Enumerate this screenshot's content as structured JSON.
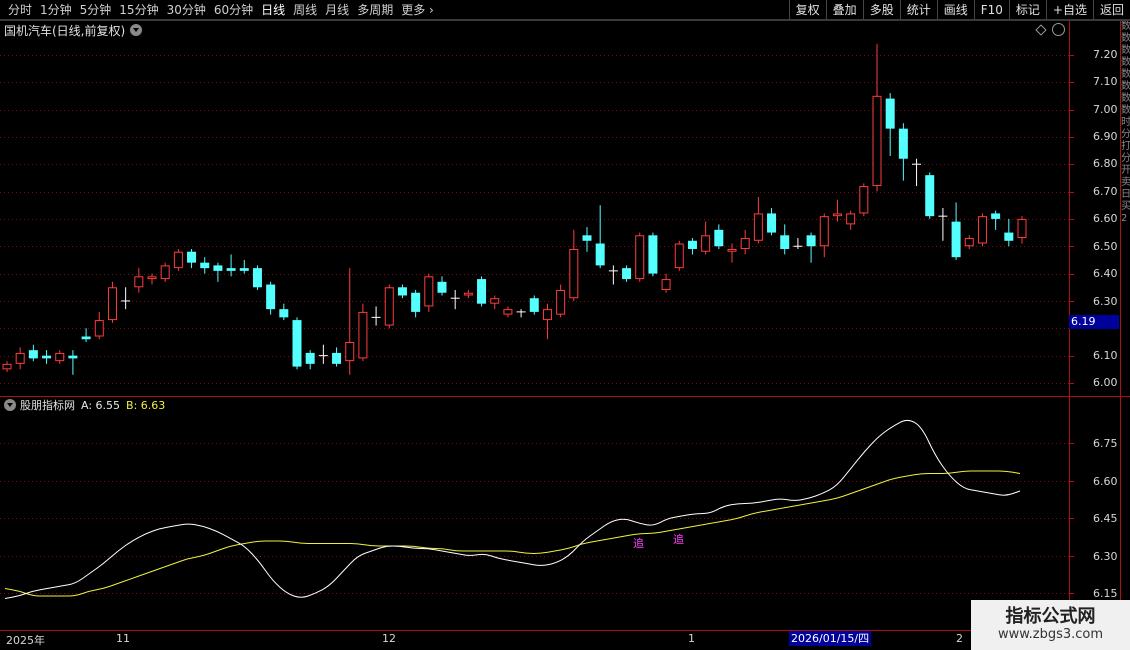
{
  "toolbar": {
    "periods": [
      "分时",
      "1分钟",
      "5分钟",
      "15分钟",
      "30分钟",
      "60分钟",
      "日线",
      "周线",
      "月线",
      "多周期",
      "更多"
    ],
    "active_period": "日线",
    "more_chevron": "›",
    "right_buttons": [
      "复权",
      "叠加",
      "多股",
      "统计",
      "画线",
      "F10",
      "标记",
      "+自选",
      "返回"
    ]
  },
  "main_chart": {
    "title": "国机汽车(日线,前复权)",
    "price_ticks": [
      "7.20",
      "7.10",
      "7.00",
      "6.90",
      "6.80",
      "6.70",
      "6.60",
      "6.50",
      "6.40",
      "6.30",
      "6.10",
      "6.00"
    ],
    "current_price_tag": "6.19"
  },
  "indicator": {
    "name": "股朋指标网",
    "a_label": "A: 6.55",
    "b_label": "B: 6.63",
    "ticks": [
      "6.75",
      "6.60",
      "6.45",
      "6.30",
      "6.15"
    ],
    "markers": [
      "追",
      "追"
    ]
  },
  "date_axis": {
    "labels": [
      "2025年",
      "11",
      "12",
      "1",
      "2"
    ],
    "highlight": "2026/01/15/四"
  },
  "side_strip": [
    "数",
    "数",
    "数",
    "数",
    "数",
    "数",
    "数",
    "数",
    "时",
    "分",
    "打",
    "分",
    "开",
    "卖",
    "日",
    "买",
    "2"
  ],
  "watermark": {
    "title": "指标公式网",
    "url": "www.zbgs3.com"
  },
  "colors": {
    "up": "#ff3c3c",
    "down": "#54ffff",
    "line_a": "#ffffff",
    "line_b": "#f0f040",
    "grid": "#7a1010",
    "price_tag_bg": "#00009a"
  },
  "chart_data": {
    "type": "candlestick",
    "ylim": [
      6.0,
      7.25
    ],
    "candles": [
      {
        "o": 6.05,
        "c": 6.07,
        "h": 6.08,
        "l": 6.04,
        "d": "up"
      },
      {
        "o": 6.07,
        "c": 6.11,
        "h": 6.13,
        "l": 6.05,
        "d": "up"
      },
      {
        "o": 6.12,
        "c": 6.09,
        "h": 6.14,
        "l": 6.08,
        "d": "down"
      },
      {
        "o": 6.1,
        "c": 6.09,
        "h": 6.12,
        "l": 6.07,
        "d": "down"
      },
      {
        "o": 6.08,
        "c": 6.11,
        "h": 6.12,
        "l": 6.07,
        "d": "up"
      },
      {
        "o": 6.1,
        "c": 6.09,
        "h": 6.12,
        "l": 6.03,
        "d": "down"
      },
      {
        "o": 6.17,
        "c": 6.16,
        "h": 6.2,
        "l": 6.15,
        "d": "down"
      },
      {
        "o": 6.17,
        "c": 6.23,
        "h": 6.26,
        "l": 6.16,
        "d": "up"
      },
      {
        "o": 6.23,
        "c": 6.35,
        "h": 6.37,
        "l": 6.22,
        "d": "up"
      },
      {
        "o": 6.3,
        "c": 6.3,
        "h": 6.35,
        "l": 6.27,
        "d": "flat"
      },
      {
        "o": 6.35,
        "c": 6.39,
        "h": 6.42,
        "l": 6.33,
        "d": "up"
      },
      {
        "o": 6.38,
        "c": 6.39,
        "h": 6.4,
        "l": 6.36,
        "d": "up"
      },
      {
        "o": 6.38,
        "c": 6.43,
        "h": 6.44,
        "l": 6.37,
        "d": "up"
      },
      {
        "o": 6.42,
        "c": 6.48,
        "h": 6.49,
        "l": 6.41,
        "d": "up"
      },
      {
        "o": 6.48,
        "c": 6.44,
        "h": 6.49,
        "l": 6.42,
        "d": "down"
      },
      {
        "o": 6.44,
        "c": 6.42,
        "h": 6.46,
        "l": 6.4,
        "d": "down"
      },
      {
        "o": 6.43,
        "c": 6.41,
        "h": 6.44,
        "l": 6.37,
        "d": "down"
      },
      {
        "o": 6.42,
        "c": 6.41,
        "h": 6.47,
        "l": 6.39,
        "d": "down"
      },
      {
        "o": 6.42,
        "c": 6.41,
        "h": 6.45,
        "l": 6.4,
        "d": "down"
      },
      {
        "o": 6.42,
        "c": 6.35,
        "h": 6.43,
        "l": 6.34,
        "d": "down"
      },
      {
        "o": 6.36,
        "c": 6.27,
        "h": 6.37,
        "l": 6.25,
        "d": "down"
      },
      {
        "o": 6.27,
        "c": 6.24,
        "h": 6.29,
        "l": 6.23,
        "d": "down"
      },
      {
        "o": 6.23,
        "c": 6.06,
        "h": 6.24,
        "l": 6.05,
        "d": "down"
      },
      {
        "o": 6.11,
        "c": 6.07,
        "h": 6.12,
        "l": 6.05,
        "d": "down"
      },
      {
        "o": 6.1,
        "c": 6.1,
        "h": 6.14,
        "l": 6.07,
        "d": "flat"
      },
      {
        "o": 6.11,
        "c": 6.07,
        "h": 6.13,
        "l": 6.06,
        "d": "down"
      },
      {
        "o": 6.08,
        "c": 6.15,
        "h": 6.42,
        "l": 6.03,
        "d": "up"
      },
      {
        "o": 6.09,
        "c": 6.26,
        "h": 6.29,
        "l": 6.08,
        "d": "up"
      },
      {
        "o": 6.24,
        "c": 6.24,
        "h": 6.28,
        "l": 6.21,
        "d": "flat"
      },
      {
        "o": 6.21,
        "c": 6.35,
        "h": 6.36,
        "l": 6.2,
        "d": "up"
      },
      {
        "o": 6.35,
        "c": 6.32,
        "h": 6.36,
        "l": 6.31,
        "d": "down"
      },
      {
        "o": 6.33,
        "c": 6.26,
        "h": 6.34,
        "l": 6.24,
        "d": "down"
      },
      {
        "o": 6.28,
        "c": 6.39,
        "h": 6.4,
        "l": 6.26,
        "d": "up"
      },
      {
        "o": 6.37,
        "c": 6.33,
        "h": 6.39,
        "l": 6.32,
        "d": "down"
      },
      {
        "o": 6.31,
        "c": 6.31,
        "h": 6.34,
        "l": 6.27,
        "d": "flat"
      },
      {
        "o": 6.32,
        "c": 6.33,
        "h": 6.34,
        "l": 6.31,
        "d": "up"
      },
      {
        "o": 6.38,
        "c": 6.29,
        "h": 6.39,
        "l": 6.28,
        "d": "down"
      },
      {
        "o": 6.29,
        "c": 6.31,
        "h": 6.32,
        "l": 6.27,
        "d": "up"
      },
      {
        "o": 6.25,
        "c": 6.27,
        "h": 6.28,
        "l": 6.24,
        "d": "up"
      },
      {
        "o": 6.26,
        "c": 6.26,
        "h": 6.27,
        "l": 6.24,
        "d": "flat"
      },
      {
        "o": 6.31,
        "c": 6.26,
        "h": 6.32,
        "l": 6.25,
        "d": "down"
      },
      {
        "o": 6.23,
        "c": 6.27,
        "h": 6.29,
        "l": 6.16,
        "d": "up"
      },
      {
        "o": 6.25,
        "c": 6.34,
        "h": 6.36,
        "l": 6.24,
        "d": "up"
      },
      {
        "o": 6.31,
        "c": 6.49,
        "h": 6.56,
        "l": 6.3,
        "d": "up"
      },
      {
        "o": 6.54,
        "c": 6.52,
        "h": 6.57,
        "l": 6.48,
        "d": "down"
      },
      {
        "o": 6.51,
        "c": 6.43,
        "h": 6.65,
        "l": 6.42,
        "d": "down"
      },
      {
        "o": 6.41,
        "c": 6.41,
        "h": 6.43,
        "l": 6.36,
        "d": "flat"
      },
      {
        "o": 6.42,
        "c": 6.38,
        "h": 6.43,
        "l": 6.37,
        "d": "down"
      },
      {
        "o": 6.38,
        "c": 6.54,
        "h": 6.55,
        "l": 6.37,
        "d": "up"
      },
      {
        "o": 6.54,
        "c": 6.4,
        "h": 6.55,
        "l": 6.39,
        "d": "down"
      },
      {
        "o": 6.34,
        "c": 6.38,
        "h": 6.4,
        "l": 6.33,
        "d": "up"
      },
      {
        "o": 6.42,
        "c": 6.51,
        "h": 6.52,
        "l": 6.41,
        "d": "up"
      },
      {
        "o": 6.52,
        "c": 6.49,
        "h": 6.53,
        "l": 6.47,
        "d": "down"
      },
      {
        "o": 6.48,
        "c": 6.54,
        "h": 6.59,
        "l": 6.47,
        "d": "up"
      },
      {
        "o": 6.56,
        "c": 6.5,
        "h": 6.58,
        "l": 6.49,
        "d": "down"
      },
      {
        "o": 6.48,
        "c": 6.49,
        "h": 6.51,
        "l": 6.44,
        "d": "up"
      },
      {
        "o": 6.49,
        "c": 6.53,
        "h": 6.56,
        "l": 6.47,
        "d": "up"
      },
      {
        "o": 6.52,
        "c": 6.62,
        "h": 6.68,
        "l": 6.51,
        "d": "up"
      },
      {
        "o": 6.62,
        "c": 6.55,
        "h": 6.64,
        "l": 6.54,
        "d": "down"
      },
      {
        "o": 6.54,
        "c": 6.49,
        "h": 6.58,
        "l": 6.47,
        "d": "down"
      },
      {
        "o": 6.5,
        "c": 6.5,
        "h": 6.53,
        "l": 6.49,
        "d": "flat"
      },
      {
        "o": 6.54,
        "c": 6.5,
        "h": 6.55,
        "l": 6.44,
        "d": "down"
      },
      {
        "o": 6.5,
        "c": 6.61,
        "h": 6.62,
        "l": 6.46,
        "d": "up"
      },
      {
        "o": 6.61,
        "c": 6.62,
        "h": 6.67,
        "l": 6.59,
        "d": "up"
      },
      {
        "o": 6.58,
        "c": 6.62,
        "h": 6.63,
        "l": 6.56,
        "d": "up"
      },
      {
        "o": 6.62,
        "c": 6.72,
        "h": 6.73,
        "l": 6.61,
        "d": "up"
      },
      {
        "o": 6.72,
        "c": 7.05,
        "h": 7.24,
        "l": 6.7,
        "d": "up"
      },
      {
        "o": 7.04,
        "c": 6.93,
        "h": 7.06,
        "l": 6.83,
        "d": "down"
      },
      {
        "o": 6.93,
        "c": 6.82,
        "h": 6.95,
        "l": 6.74,
        "d": "down"
      },
      {
        "o": 6.8,
        "c": 6.8,
        "h": 6.82,
        "l": 6.72,
        "d": "flat"
      },
      {
        "o": 6.76,
        "c": 6.61,
        "h": 6.77,
        "l": 6.6,
        "d": "down"
      },
      {
        "o": 6.61,
        "c": 6.61,
        "h": 6.64,
        "l": 6.52,
        "d": "flat"
      },
      {
        "o": 6.59,
        "c": 6.46,
        "h": 6.66,
        "l": 6.45,
        "d": "down"
      },
      {
        "o": 6.5,
        "c": 6.53,
        "h": 6.54,
        "l": 6.49,
        "d": "up"
      },
      {
        "o": 6.51,
        "c": 6.61,
        "h": 6.62,
        "l": 6.5,
        "d": "up"
      },
      {
        "o": 6.62,
        "c": 6.6,
        "h": 6.63,
        "l": 6.56,
        "d": "down"
      },
      {
        "o": 6.55,
        "c": 6.52,
        "h": 6.6,
        "l": 6.5,
        "d": "down"
      },
      {
        "o": 6.53,
        "c": 6.6,
        "h": 6.61,
        "l": 6.51,
        "d": "up"
      }
    ],
    "indicator_ylim": [
      6.15,
      6.83
    ],
    "indicator_a": [
      6.13,
      6.14,
      6.16,
      6.17,
      6.18,
      6.19,
      6.23,
      6.27,
      6.32,
      6.36,
      6.39,
      6.41,
      6.42,
      6.43,
      6.42,
      6.4,
      6.37,
      6.34,
      6.28,
      6.2,
      6.15,
      6.13,
      6.15,
      6.18,
      6.24,
      6.3,
      6.32,
      6.34,
      6.34,
      6.33,
      6.33,
      6.32,
      6.31,
      6.3,
      6.31,
      6.29,
      6.28,
      6.27,
      6.26,
      6.27,
      6.3,
      6.36,
      6.4,
      6.44,
      6.45,
      6.43,
      6.42,
      6.45,
      6.46,
      6.47,
      6.47,
      6.5,
      6.51,
      6.51,
      6.52,
      6.53,
      6.52,
      6.53,
      6.55,
      6.58,
      6.65,
      6.72,
      6.78,
      6.82,
      6.85,
      6.82,
      6.7,
      6.62,
      6.57,
      6.56,
      6.55,
      6.54,
      6.56
    ],
    "indicator_b": [
      6.17,
      6.16,
      6.14,
      6.14,
      6.14,
      6.14,
      6.16,
      6.17,
      6.19,
      6.21,
      6.23,
      6.25,
      6.27,
      6.29,
      6.3,
      6.32,
      6.34,
      6.35,
      6.36,
      6.36,
      6.36,
      6.35,
      6.35,
      6.35,
      6.35,
      6.35,
      6.34,
      6.34,
      6.34,
      6.34,
      6.33,
      6.33,
      6.32,
      6.32,
      6.32,
      6.32,
      6.32,
      6.31,
      6.31,
      6.32,
      6.33,
      6.35,
      6.36,
      6.37,
      6.38,
      6.39,
      6.39,
      6.4,
      6.41,
      6.42,
      6.43,
      6.44,
      6.45,
      6.47,
      6.48,
      6.49,
      6.5,
      6.51,
      6.52,
      6.53,
      6.55,
      6.57,
      6.59,
      6.61,
      6.62,
      6.63,
      6.63,
      6.63,
      6.64,
      6.64,
      6.64,
      6.64,
      6.63
    ]
  }
}
